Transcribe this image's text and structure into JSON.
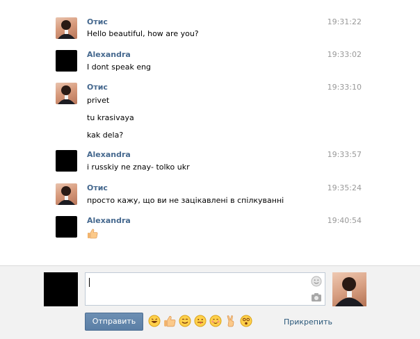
{
  "messages": [
    {
      "author": "Отис",
      "avatar": "otis-photo",
      "time": "19:31:22",
      "lines": [
        "Hello beautiful, how are you?"
      ]
    },
    {
      "author": "Alexandra",
      "avatar": "black-square",
      "time": "19:33:02",
      "lines": [
        "I dont speak eng"
      ]
    },
    {
      "author": "Отис",
      "avatar": "otis-photo",
      "time": "19:33:10",
      "lines": [
        "privet",
        "tu krasivaya",
        "kak dela?"
      ]
    },
    {
      "author": "Alexandra",
      "avatar": "black-square",
      "time": "19:33:57",
      "lines": [
        "i russkiy ne znay- tolko ukr"
      ]
    },
    {
      "author": "Отис",
      "avatar": "otis-photo",
      "time": "19:35:24",
      "lines": [
        "просто кажу, що ви не зацікавлені в спілкуванні"
      ]
    },
    {
      "author": "Alexandra",
      "avatar": "black-square",
      "time": "19:40:54",
      "lines": [],
      "emoji": "thumbs-up-icon"
    }
  ],
  "composer": {
    "send_label": "Отправить",
    "attach_label": "Прикрепить",
    "emoji": [
      "laughing-face-icon",
      "thumbs-up-icon",
      "smiling-face-icon",
      "tongue-face-icon",
      "blushing-face-icon",
      "victory-hand-icon",
      "dizzy-face-icon"
    ]
  },
  "colors": {
    "author": "#45688e",
    "time": "#999999",
    "send_button": "#5b7fa6",
    "link": "#2b587a"
  }
}
